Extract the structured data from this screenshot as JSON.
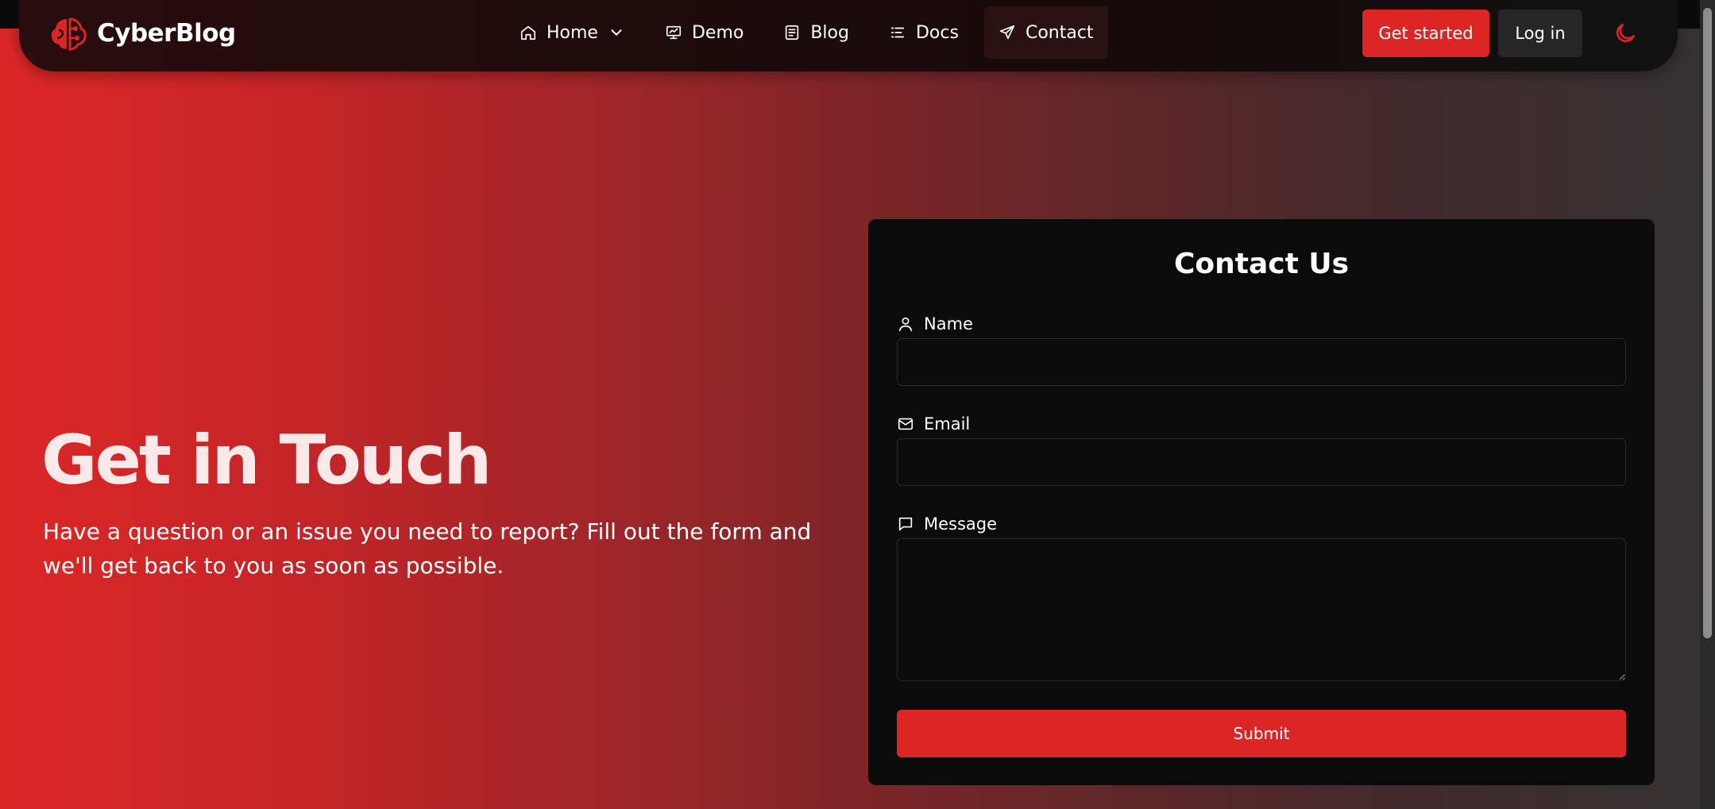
{
  "brand": {
    "name": "CyberBlog",
    "accent": "#dc2626"
  },
  "nav": {
    "items": [
      {
        "label": "Home",
        "icon": "home-icon",
        "has_dropdown": true
      },
      {
        "label": "Demo",
        "icon": "presentation-icon"
      },
      {
        "label": "Blog",
        "icon": "newspaper-icon"
      },
      {
        "label": "Docs",
        "icon": "list-icon"
      },
      {
        "label": "Contact",
        "icon": "send-icon",
        "active": true
      }
    ],
    "get_started": "Get started",
    "log_in": "Log in",
    "theme_icon": "moon-icon"
  },
  "hero": {
    "title": "Get in Touch",
    "text": "Have a question or an issue you need to report? Fill out the form and we'll get back to you as soon as possible."
  },
  "form": {
    "title": "Contact Us",
    "name_label": "Name",
    "email_label": "Email",
    "message_label": "Message",
    "name_value": "",
    "email_value": "",
    "message_value": "",
    "submit": "Submit"
  }
}
